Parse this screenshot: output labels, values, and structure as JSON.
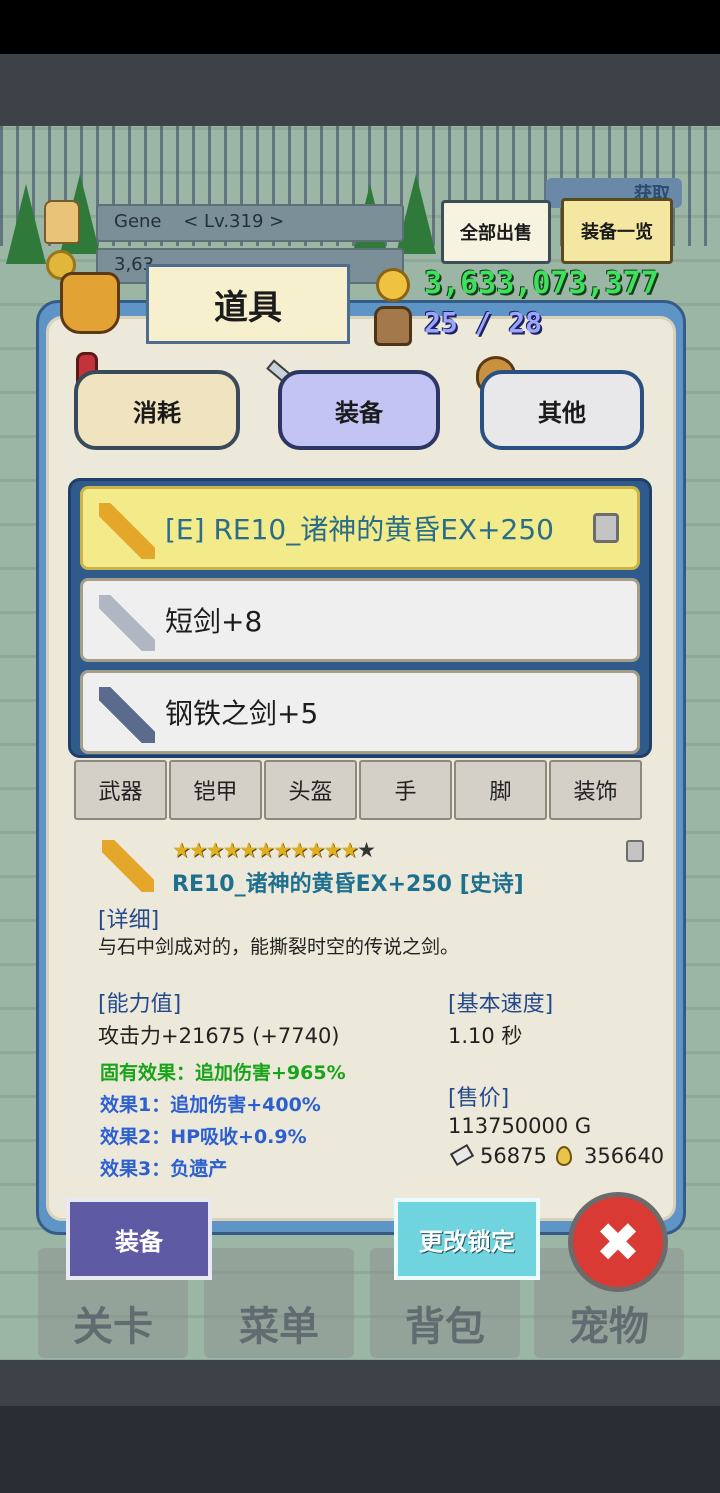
{
  "hud": {
    "player_name": "Gene",
    "player_level": "< Lv.319 >",
    "player_gold_partial": "3,63",
    "top_right_label": "获取",
    "sell_all": "全部出售",
    "equip_list": "装备一览"
  },
  "panel": {
    "title": "道具",
    "gold": "3,633,073,377",
    "bag_count": "25 / 28"
  },
  "categories": [
    "消耗",
    "装备",
    "其他"
  ],
  "items": [
    {
      "name": "[E] RE10_诸神的黄昏EX+250",
      "selected": true,
      "locked": true
    },
    {
      "name": "短剑+8",
      "selected": false,
      "locked": false
    },
    {
      "name": "钢铁之剑+5",
      "selected": false,
      "locked": false
    }
  ],
  "filters": [
    "武器",
    "铠甲",
    "头盔",
    "手",
    "脚",
    "装饰"
  ],
  "detail": {
    "stars": "★★★★★★★★★★★",
    "star_empty": "★",
    "item_name": "RE10_诸神的黄昏EX+250 [史诗]",
    "detail_label": "[详细]",
    "description": "与石中剑成对的，能撕裂时空的传说之剑。",
    "stats_label": "[能力值]",
    "attack": "攻击力+21675 (+7740)",
    "effect_inherent": "固有效果：追加伤害+965%",
    "effect1": "效果1：追加伤害+400%",
    "effect2": "效果2：HP吸收+0.9%",
    "effect3": "效果3：负遗产",
    "speed_label": "[基本速度]",
    "speed_value": "1.10 秒",
    "price_label": "[售价]",
    "price_value": "113750000 G",
    "shards": "56875",
    "drops": "356640"
  },
  "buttons": {
    "equip": "装备",
    "change_lock": "更改锁定",
    "close": "✖"
  },
  "nav": [
    "关卡",
    "菜单",
    "背包",
    "宠物"
  ],
  "colors": {
    "selected_row": "#f3ea8a",
    "panel_blue": "#5f95c6",
    "gold_green": "#3fe05b"
  }
}
